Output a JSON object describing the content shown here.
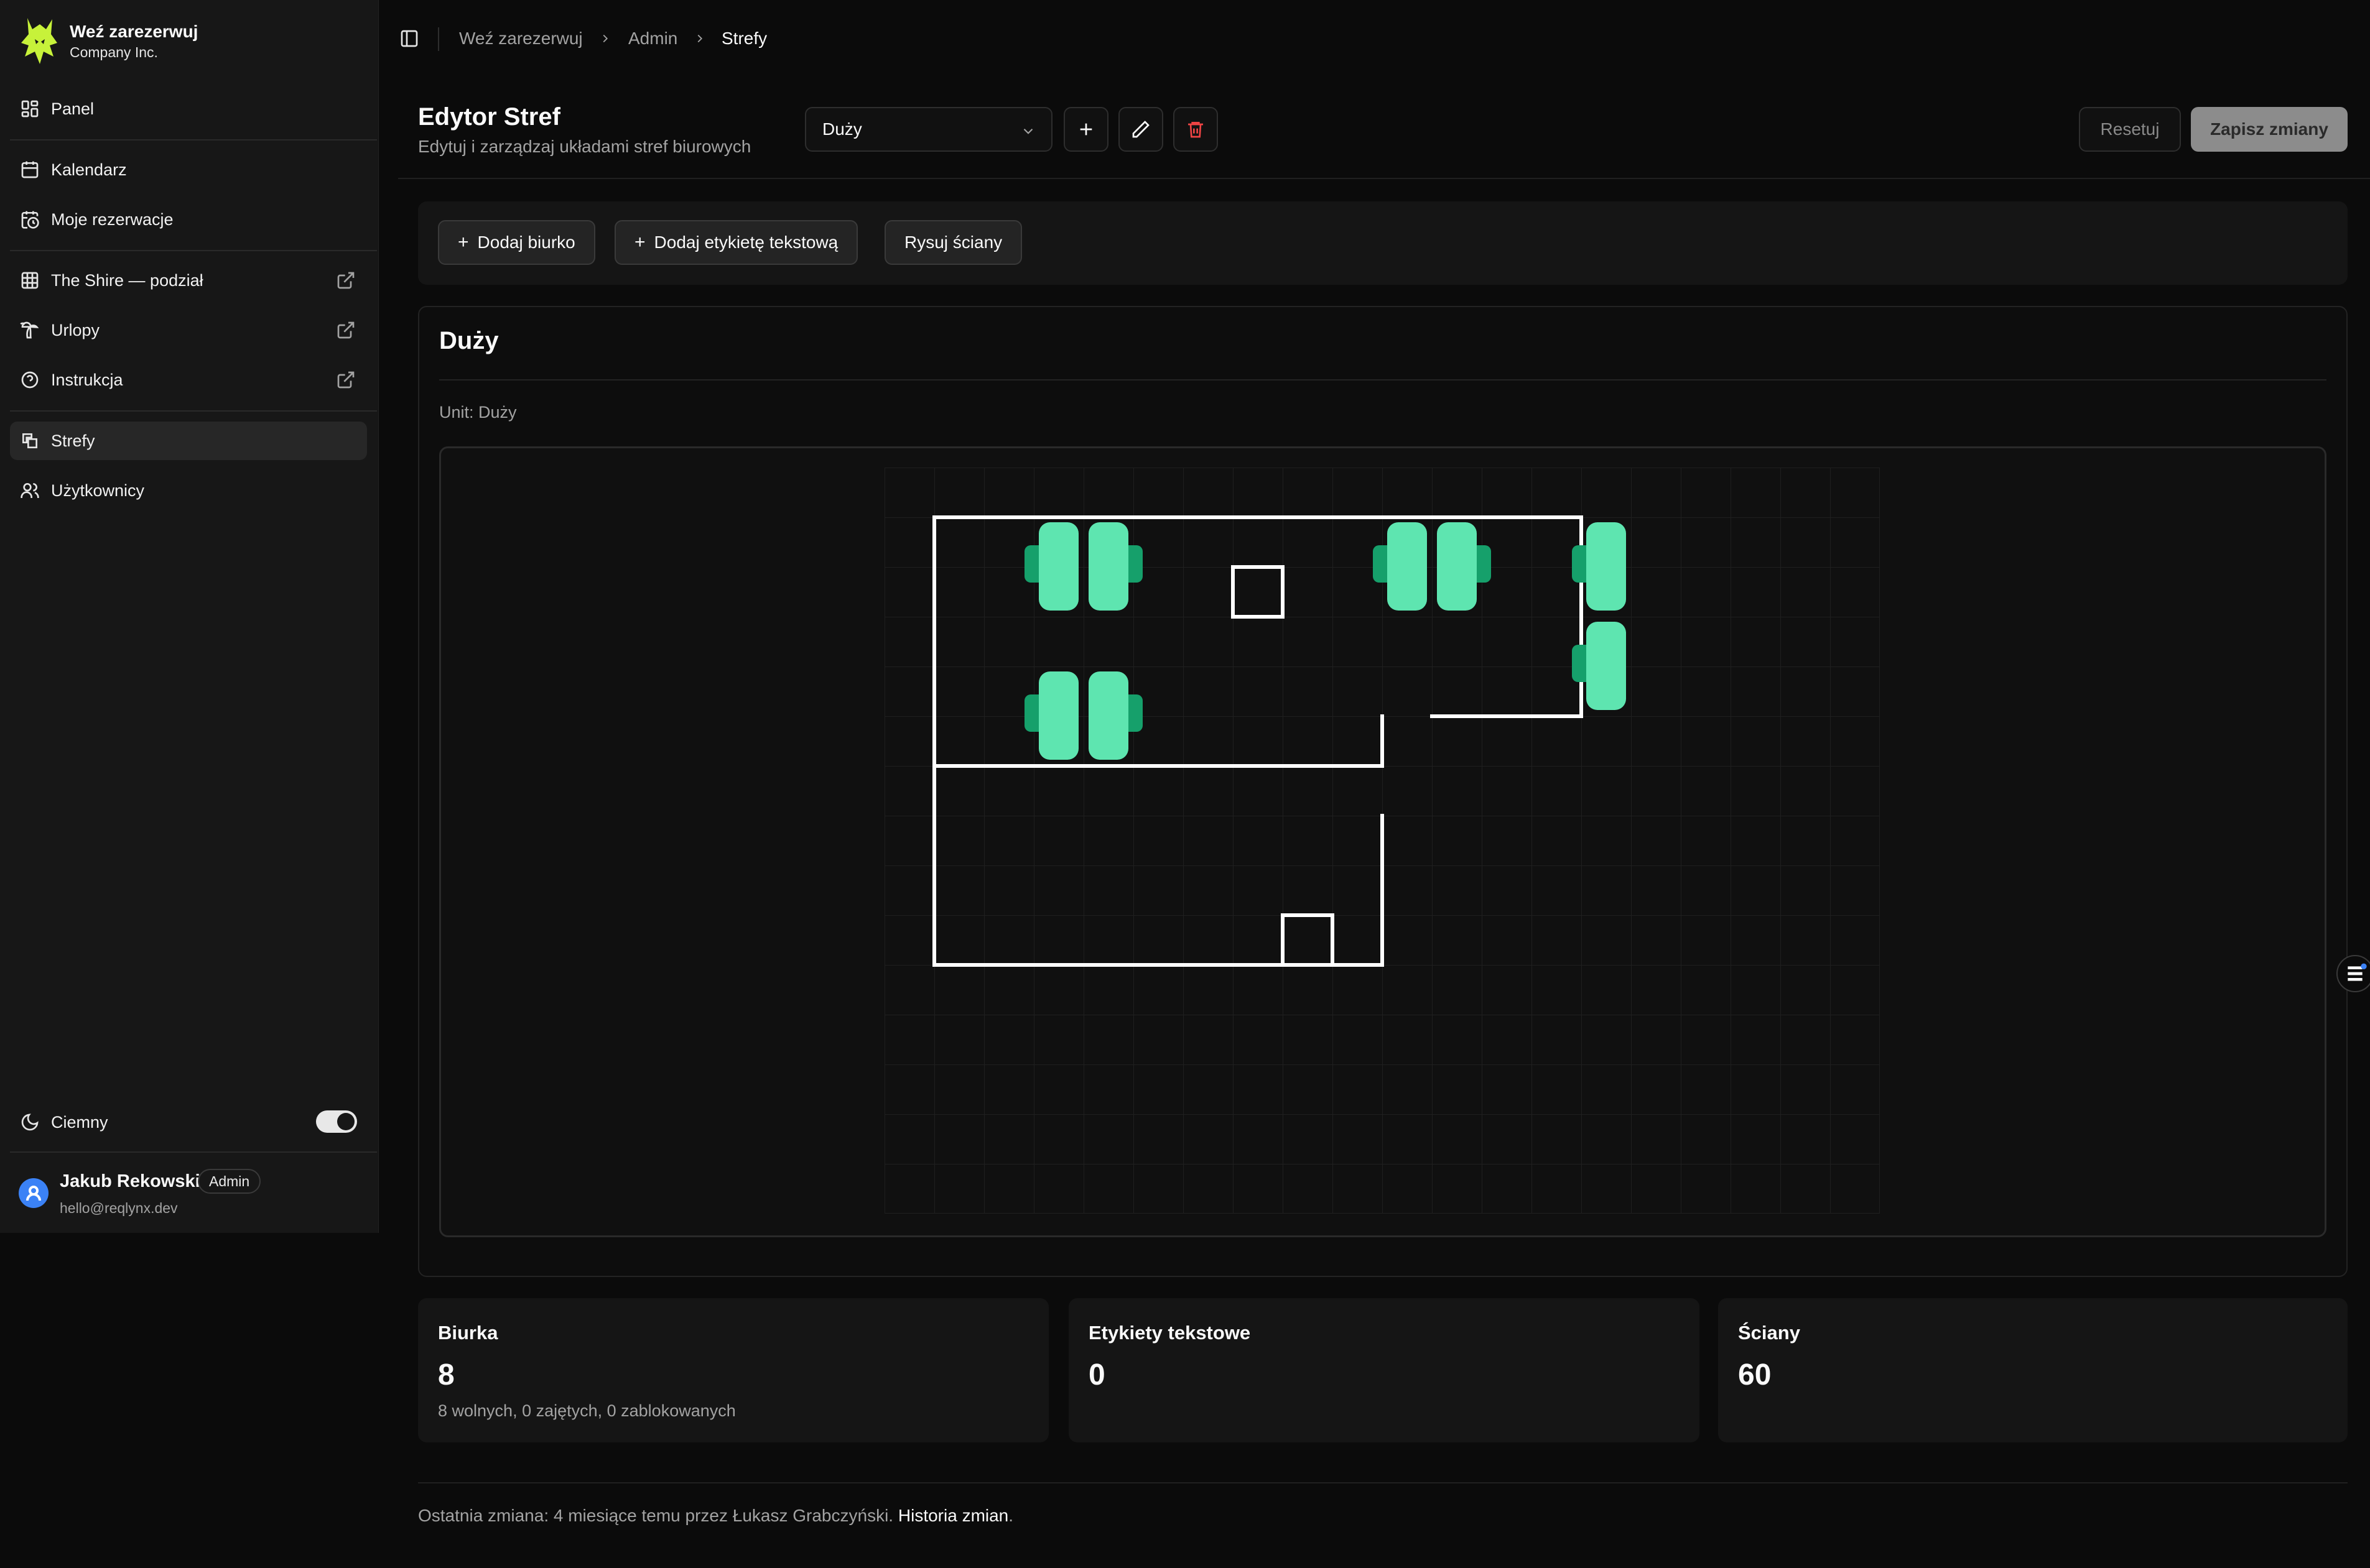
{
  "brand": {
    "name": "Weź zarezerwuj",
    "company": "Company Inc."
  },
  "sidebar": {
    "items": [
      {
        "label": "Panel",
        "icon": "dashboard-icon"
      },
      {
        "label": "Kalendarz",
        "icon": "calendar-icon"
      },
      {
        "label": "Moje rezerwacje",
        "icon": "calendar-clock-icon"
      },
      {
        "label": "The Shire — podział",
        "icon": "table-icon",
        "external": true
      },
      {
        "label": "Urlopy",
        "icon": "palm-tree-icon",
        "external": true
      },
      {
        "label": "Instrukcja",
        "icon": "help-circle-icon",
        "external": true
      },
      {
        "label": "Strefy",
        "icon": "zones-icon",
        "active": true
      },
      {
        "label": "Użytkownicy",
        "icon": "users-icon"
      }
    ],
    "theme_label": "Ciemny",
    "theme_dark": true
  },
  "user": {
    "name": "Jakub Rekowski",
    "role": "Admin",
    "email": "hello@reqlynx.dev"
  },
  "breadcrumb": [
    "Weź zarezerwuj",
    "Admin",
    "Strefy"
  ],
  "header": {
    "title": "Edytor Stref",
    "subtitle": "Edytuj i zarządzaj układami stref biurowych",
    "zone_selected": "Duży",
    "reset_label": "Resetuj",
    "save_label": "Zapisz zmiany"
  },
  "toolbar": {
    "add_desk": "Dodaj biurko",
    "add_label": "Dodaj etykietę tekstową",
    "draw_walls": "Rysuj ściany"
  },
  "canvas": {
    "title": "Duży",
    "unit": "Unit: Duży"
  },
  "stats": [
    {
      "label": "Biurka",
      "value": "8",
      "sub": "8 wolnych, 0 zajętych, 0 zablokowanych"
    },
    {
      "label": "Etykiety tekstowe",
      "value": "0",
      "sub": ""
    },
    {
      "label": "Ściany",
      "value": "60",
      "sub": ""
    }
  ],
  "footer": {
    "text": "Ostatnia zmiana: 4 miesiące temu przez Łukasz Grabczyński.",
    "link": "Historia zmian",
    "end": "."
  },
  "colors": {
    "desk": "#5ee5b0",
    "desk_chair": "#16a06b",
    "wall": "#ffffff",
    "save_disabled": "#8c8c8c",
    "delete": "#ef4444",
    "avatar": "#3b82f6"
  }
}
